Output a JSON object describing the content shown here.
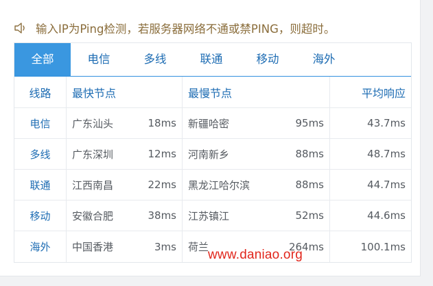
{
  "notice": {
    "icon": "speaker-icon",
    "text": "输入IP为Ping检测，若服务器网络不通或禁PING，则超时。"
  },
  "tabs": [
    {
      "label": "全部",
      "active": true
    },
    {
      "label": "电信",
      "active": false
    },
    {
      "label": "多线",
      "active": false
    },
    {
      "label": "联通",
      "active": false
    },
    {
      "label": "移动",
      "active": false
    },
    {
      "label": "海外",
      "active": false
    }
  ],
  "table": {
    "headers": {
      "line": "线路",
      "fastest": "最快节点",
      "slowest": "最慢节点",
      "average": "平均响应"
    },
    "rows": [
      {
        "line": "电信",
        "fast_node": "广东汕头",
        "fast_ms": "18ms",
        "slow_node": "新疆哈密",
        "slow_ms": "95ms",
        "avg": "43.7ms"
      },
      {
        "line": "多线",
        "fast_node": "广东深圳",
        "fast_ms": "12ms",
        "slow_node": "河南新乡",
        "slow_ms": "88ms",
        "avg": "48.7ms"
      },
      {
        "line": "联通",
        "fast_node": "江西南昌",
        "fast_ms": "22ms",
        "slow_node": "黑龙江哈尔滨",
        "slow_ms": "88ms",
        "avg": "44.7ms"
      },
      {
        "line": "移动",
        "fast_node": "安徽合肥",
        "fast_ms": "38ms",
        "slow_node": "江苏镇江",
        "slow_ms": "52ms",
        "avg": "44.6ms"
      },
      {
        "line": "海外",
        "fast_node": "中国香港",
        "fast_ms": "3ms",
        "slow_node": "荷兰",
        "slow_ms": "264ms",
        "avg": "100.1ms"
      }
    ]
  },
  "watermark": "www.daniao.org",
  "colors": {
    "accent": "#3a97e0",
    "link": "#1d6cb3",
    "notice": "#8a6d3b",
    "watermark": "#e1261c"
  }
}
